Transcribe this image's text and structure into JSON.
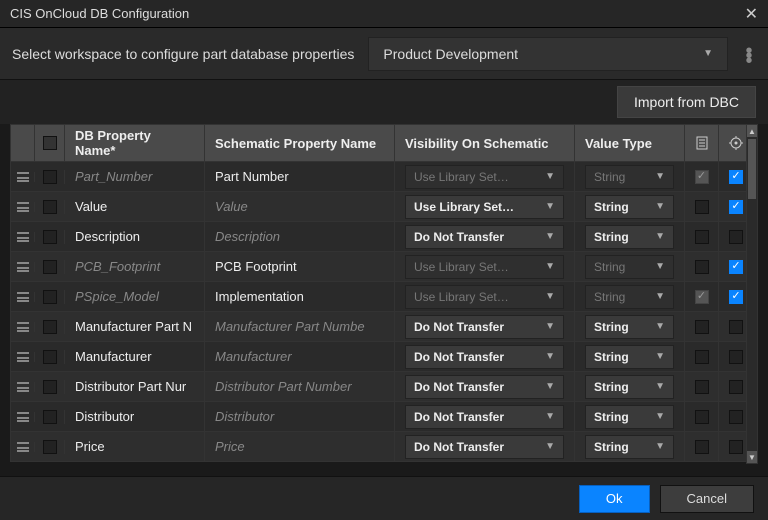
{
  "window": {
    "title": "CIS OnCloud DB Configuration"
  },
  "workspace": {
    "label": "Select workspace to configure part database properties",
    "selected": "Product Development"
  },
  "toolbar": {
    "import_label": "Import from DBC"
  },
  "grid": {
    "headers": {
      "dbname": "DB Property Name*",
      "schem": "Schematic Property Name",
      "vis": "Visibility On Schematic",
      "vtype": "Value Type"
    },
    "rows": [
      {
        "dbname": "Part_Number",
        "schem": "Part Number",
        "vis": "Use Library Set…",
        "vtype": "String",
        "locked": true,
        "c1": "greychk",
        "c2": "checked",
        "schem_dim": false,
        "dbname_dim": true,
        "vis_disabled": true,
        "vtype_disabled": true
      },
      {
        "dbname": "Value",
        "schem": "Value",
        "vis": "Use Library Set…",
        "vtype": "String",
        "locked": false,
        "c1": "",
        "c2": "checked",
        "schem_dim": true
      },
      {
        "dbname": "Description",
        "schem": "Description",
        "vis": "Do Not Transfer",
        "vtype": "String",
        "locked": false,
        "c1": "",
        "c2": "",
        "schem_dim": true
      },
      {
        "dbname": "PCB_Footprint",
        "schem": "PCB Footprint",
        "vis": "Use Library Set…",
        "vtype": "String",
        "locked": true,
        "c1": "",
        "c2": "checked",
        "schem_dim": false,
        "dbname_dim": true,
        "vis_disabled": true,
        "vtype_disabled": true
      },
      {
        "dbname": "PSpice_Model",
        "schem": "Implementation",
        "vis": "Use Library Set…",
        "vtype": "String",
        "locked": true,
        "c1": "greychk",
        "c2": "checked",
        "schem_dim": false,
        "dbname_dim": true,
        "vis_disabled": true,
        "vtype_disabled": true
      },
      {
        "dbname": "Manufacturer Part N",
        "schem": "Manufacturer Part Numbe",
        "vis": "Do Not Transfer",
        "vtype": "String",
        "locked": false,
        "c1": "",
        "c2": "",
        "schem_dim": true
      },
      {
        "dbname": "Manufacturer",
        "schem": "Manufacturer",
        "vis": "Do Not Transfer",
        "vtype": "String",
        "locked": false,
        "c1": "",
        "c2": "",
        "schem_dim": true
      },
      {
        "dbname": "Distributor Part Nur",
        "schem": "Distributor Part Number",
        "vis": "Do Not Transfer",
        "vtype": "String",
        "locked": false,
        "c1": "",
        "c2": "",
        "schem_dim": true
      },
      {
        "dbname": "Distributor",
        "schem": "Distributor",
        "vis": "Do Not Transfer",
        "vtype": "String",
        "locked": false,
        "c1": "",
        "c2": "",
        "schem_dim": true
      },
      {
        "dbname": "Price",
        "schem": "Price",
        "vis": "Do Not Transfer",
        "vtype": "String",
        "locked": false,
        "c1": "",
        "c2": "",
        "schem_dim": true
      }
    ]
  },
  "footer": {
    "ok": "Ok",
    "cancel": "Cancel"
  }
}
